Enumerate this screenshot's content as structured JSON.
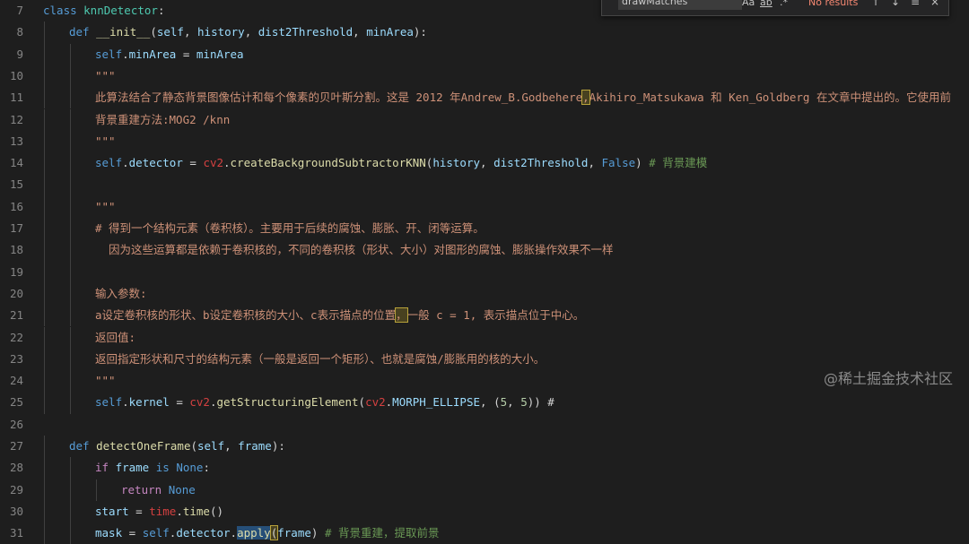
{
  "find_widget": {
    "query": "drawMatches",
    "results": "No results",
    "opt_case": "Aa",
    "opt_word": "ab",
    "opt_regex": ".*",
    "btn_prev": "↑",
    "btn_next": "↓",
    "btn_sel": "≡",
    "btn_close": "×"
  },
  "watermark": "@稀土掘金技术社区",
  "lines": [
    {
      "n": "7",
      "segs": [
        [
          "kw",
          "class "
        ],
        [
          "cls",
          "knnDetector"
        ],
        [
          "op",
          ":"
        ]
      ]
    },
    {
      "n": "8",
      "segs": [
        [
          "kw",
          "def "
        ],
        [
          "fn",
          "__init__"
        ],
        [
          "op",
          "("
        ],
        [
          "param",
          "self"
        ],
        [
          "op",
          ", "
        ],
        [
          "param",
          "history"
        ],
        [
          "op",
          ", "
        ],
        [
          "param",
          "dist2Threshold"
        ],
        [
          "op",
          ", "
        ],
        [
          "param",
          "minArea"
        ],
        [
          "op",
          "):"
        ]
      ]
    },
    {
      "n": "9",
      "segs": [
        [
          "kw",
          "self"
        ],
        [
          "op",
          "."
        ],
        [
          "param",
          "minArea"
        ],
        [
          "op",
          " = "
        ],
        [
          "param",
          "minArea"
        ]
      ]
    },
    {
      "n": "10",
      "segs": [
        [
          "str",
          "\"\"\""
        ]
      ]
    },
    {
      "n": "11",
      "segs": [
        [
          "str",
          "此算法结合了静态背景图像估计和每个像素的贝叶斯分割。这是 2012 年Andrew_B.Godbehere"
        ],
        [
          "strhl",
          ","
        ],
        [
          "str",
          "Akihiro_Matsukawa 和 Ken_Goldberg 在文章中提出的。它使用前"
        ]
      ]
    },
    {
      "n": "12",
      "segs": [
        [
          "str",
          "背景重建方法:MOG2 /knn"
        ]
      ]
    },
    {
      "n": "13",
      "segs": [
        [
          "str",
          "\"\"\""
        ]
      ]
    },
    {
      "n": "14",
      "segs": [
        [
          "kw",
          "self"
        ],
        [
          "op",
          "."
        ],
        [
          "param",
          "detector"
        ],
        [
          "op",
          " = "
        ],
        [
          "mod",
          "cv2"
        ],
        [
          "op",
          "."
        ],
        [
          "fn",
          "createBackgroundSubtractorKNN"
        ],
        [
          "op",
          "("
        ],
        [
          "param",
          "history"
        ],
        [
          "op",
          ", "
        ],
        [
          "param",
          "dist2Threshold"
        ],
        [
          "op",
          ", "
        ],
        [
          "kw",
          "False"
        ],
        [
          "op",
          ") "
        ],
        [
          "cm",
          "# 背景建模"
        ]
      ]
    },
    {
      "n": "15",
      "segs": []
    },
    {
      "n": "16",
      "segs": [
        [
          "str",
          "\"\"\""
        ]
      ]
    },
    {
      "n": "17",
      "segs": [
        [
          "str",
          "# 得到一个结构元素（卷积核）。主要用于后续的腐蚀、膨胀、开、闭等运算。"
        ]
      ]
    },
    {
      "n": "18",
      "segs": [
        [
          "str",
          "  因为这些运算都是依赖于卷积核的，不同的卷积核（形状、大小）对图形的腐蚀、膨胀操作效果不一样"
        ]
      ]
    },
    {
      "n": "19",
      "segs": []
    },
    {
      "n": "20",
      "segs": [
        [
          "str",
          "输入参数:"
        ]
      ]
    },
    {
      "n": "21",
      "segs": [
        [
          "str",
          "a设定卷积核的形状、b设定卷积核的大小、c表示描点的位置"
        ],
        [
          "strhl",
          "，"
        ],
        [
          "str",
          "一般 c = 1, 表示描点位于中心。"
        ]
      ]
    },
    {
      "n": "22",
      "segs": [
        [
          "str",
          "返回值:"
        ]
      ]
    },
    {
      "n": "23",
      "segs": [
        [
          "str",
          "返回指定形状和尺寸的结构元素（一般是返回一个矩形）、也就是腐蚀/膨胀用的核的大小。"
        ]
      ]
    },
    {
      "n": "24",
      "segs": [
        [
          "str",
          "\"\"\""
        ]
      ]
    },
    {
      "n": "25",
      "segs": [
        [
          "kw",
          "self"
        ],
        [
          "op",
          "."
        ],
        [
          "param",
          "kernel"
        ],
        [
          "op",
          " = "
        ],
        [
          "mod",
          "cv2"
        ],
        [
          "op",
          "."
        ],
        [
          "fn",
          "getStructuringElement"
        ],
        [
          "op",
          "("
        ],
        [
          "mod",
          "cv2"
        ],
        [
          "op",
          "."
        ],
        [
          "param",
          "MORPH_ELLIPSE"
        ],
        [
          "op",
          ", ("
        ],
        [
          "num",
          "5"
        ],
        [
          "op",
          ", "
        ],
        [
          "num",
          "5"
        ],
        [
          "op",
          ")) #"
        ]
      ]
    },
    {
      "n": "26",
      "segs": []
    },
    {
      "n": "27",
      "segs": [
        [
          "kw",
          "def "
        ],
        [
          "fn",
          "detectOneFrame"
        ],
        [
          "op",
          "("
        ],
        [
          "param",
          "self"
        ],
        [
          "op",
          ", "
        ],
        [
          "param",
          "frame"
        ],
        [
          "op",
          "):"
        ]
      ]
    },
    {
      "n": "28",
      "segs": [
        [
          "kw2",
          "if "
        ],
        [
          "param",
          "frame"
        ],
        [
          "kw",
          " is "
        ],
        [
          "kw",
          "None"
        ],
        [
          "op",
          ":"
        ]
      ]
    },
    {
      "n": "29",
      "segs": [
        [
          "kw2",
          "return "
        ],
        [
          "kw",
          "None"
        ]
      ]
    },
    {
      "n": "30",
      "segs": [
        [
          "param",
          "start"
        ],
        [
          "op",
          " = "
        ],
        [
          "mod",
          "time"
        ],
        [
          "op",
          "."
        ],
        [
          "fn",
          "time"
        ],
        [
          "op",
          "()"
        ]
      ]
    },
    {
      "n": "31",
      "segs": [
        [
          "param",
          "mask"
        ],
        [
          "op",
          " = "
        ],
        [
          "kw",
          "self"
        ],
        [
          "op",
          "."
        ],
        [
          "param",
          "detector"
        ],
        [
          "op",
          "."
        ],
        [
          "fnsel",
          "apply"
        ],
        [
          "ophl",
          "("
        ],
        [
          "param",
          "frame"
        ],
        [
          "op",
          ") "
        ],
        [
          "cm",
          "# 背景重建，提取前景"
        ]
      ]
    }
  ]
}
